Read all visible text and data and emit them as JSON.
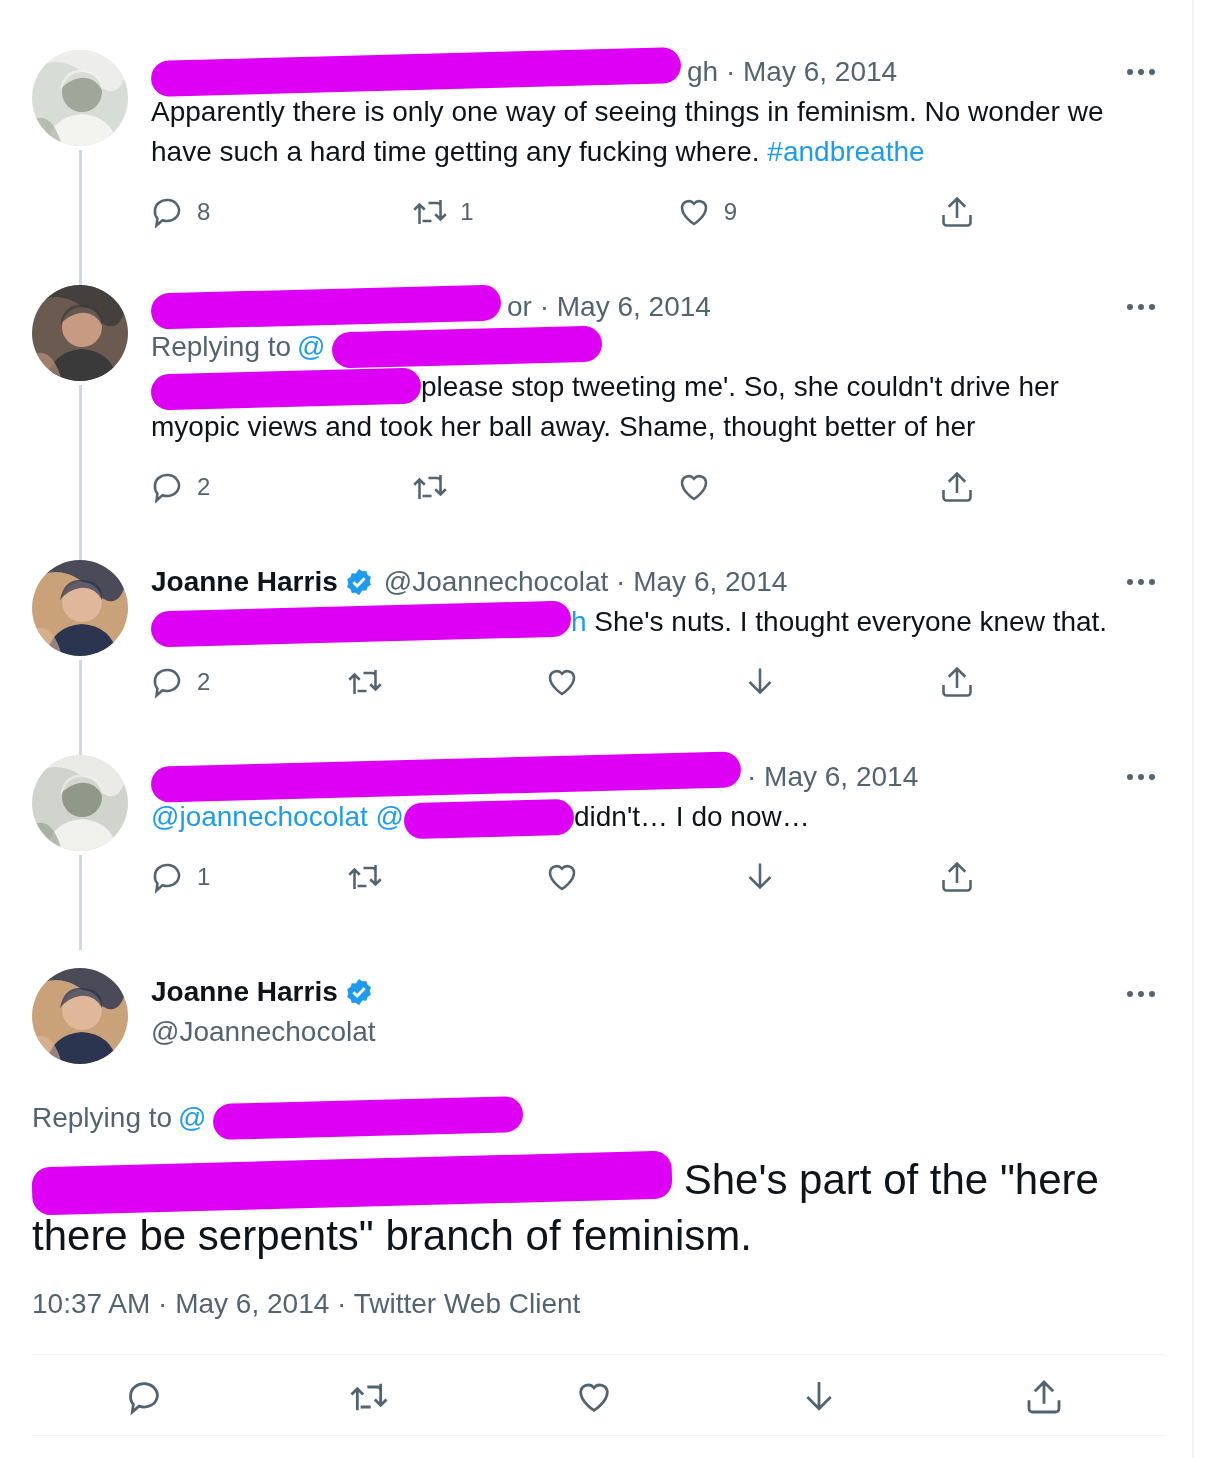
{
  "thread": [
    {
      "avatar": {
        "kind": "picture"
      },
      "header": [
        {
          "kind": "redaction"
        },
        {
          "kind": "meta",
          "text": "gh · May 6, 2014"
        }
      ],
      "body": [
        {
          "kind": "text",
          "text": "Apparently there is only one way of seeing things in feminism. No wonder we have such a hard time getting any fucking where. "
        },
        {
          "kind": "link",
          "text": "#andbreathe"
        }
      ],
      "actions": [
        {
          "kind": "reply",
          "count": "8"
        },
        {
          "kind": "retweet",
          "count": "1"
        },
        {
          "kind": "like",
          "count": "9"
        },
        {
          "kind": "share"
        }
      ]
    },
    {
      "avatar": {
        "kind": "picture"
      },
      "header": [
        {
          "kind": "redaction"
        },
        {
          "kind": "meta",
          "text": "or · May 6, 2014"
        }
      ],
      "reply_to": [
        {
          "kind": "meta",
          "text": "Replying to"
        },
        {
          "kind": "link",
          "text": "@"
        },
        {
          "kind": "redaction"
        }
      ],
      "body": [
        {
          "kind": "redaction"
        },
        {
          "kind": "text",
          "text": "please stop tweeting me'. So, she couldn't drive her myopic views and took her ball away. Shame, thought better of her"
        }
      ],
      "actions": [
        {
          "kind": "reply",
          "count": "2"
        },
        {
          "kind": "retweet"
        },
        {
          "kind": "like"
        },
        {
          "kind": "share"
        }
      ]
    },
    {
      "avatar": {
        "kind": "picture"
      },
      "header": [
        {
          "kind": "name",
          "text": "Joanne Harris"
        },
        {
          "kind": "verified"
        },
        {
          "kind": "meta",
          "text": "@Joannechocolat · May 6, 2014"
        }
      ],
      "body": [
        {
          "kind": "redaction"
        },
        {
          "kind": "link",
          "text": "h"
        },
        {
          "kind": "text",
          "text": " She's nuts. I thought everyone knew that."
        }
      ],
      "actions": [
        {
          "kind": "reply",
          "count": "2"
        },
        {
          "kind": "retweet"
        },
        {
          "kind": "like"
        },
        {
          "kind": "download"
        },
        {
          "kind": "share"
        }
      ]
    },
    {
      "avatar": {
        "kind": "picture"
      },
      "header": [
        {
          "kind": "redaction"
        },
        {
          "kind": "meta",
          "text": "· May 6, 2014"
        }
      ],
      "body": [
        {
          "kind": "link",
          "text": "@joannechocolat @"
        },
        {
          "kind": "redaction"
        },
        {
          "kind": "text",
          "text": "didn't… I do now…"
        }
      ],
      "actions": [
        {
          "kind": "reply",
          "count": "1"
        },
        {
          "kind": "retweet"
        },
        {
          "kind": "like"
        },
        {
          "kind": "download"
        },
        {
          "kind": "share"
        }
      ]
    }
  ],
  "main_tweet": {
    "avatar": {
      "kind": "picture"
    },
    "name": "Joanne Harris",
    "verified": true,
    "handle": "@Joannechocolat",
    "reply_to": [
      {
        "kind": "meta",
        "text": "Replying to"
      },
      {
        "kind": "link",
        "text": "@"
      },
      {
        "kind": "redaction"
      }
    ],
    "body": [
      {
        "kind": "redaction"
      },
      {
        "kind": "text",
        "text": " She's part of the \"here there be serpents\" branch of feminism."
      }
    ],
    "meta": "10:37 AM · May 6, 2014 · Twitter Web Client",
    "actions": [
      {
        "kind": "reply"
      },
      {
        "kind": "retweet"
      },
      {
        "kind": "like"
      },
      {
        "kind": "download"
      },
      {
        "kind": "share"
      }
    ]
  }
}
